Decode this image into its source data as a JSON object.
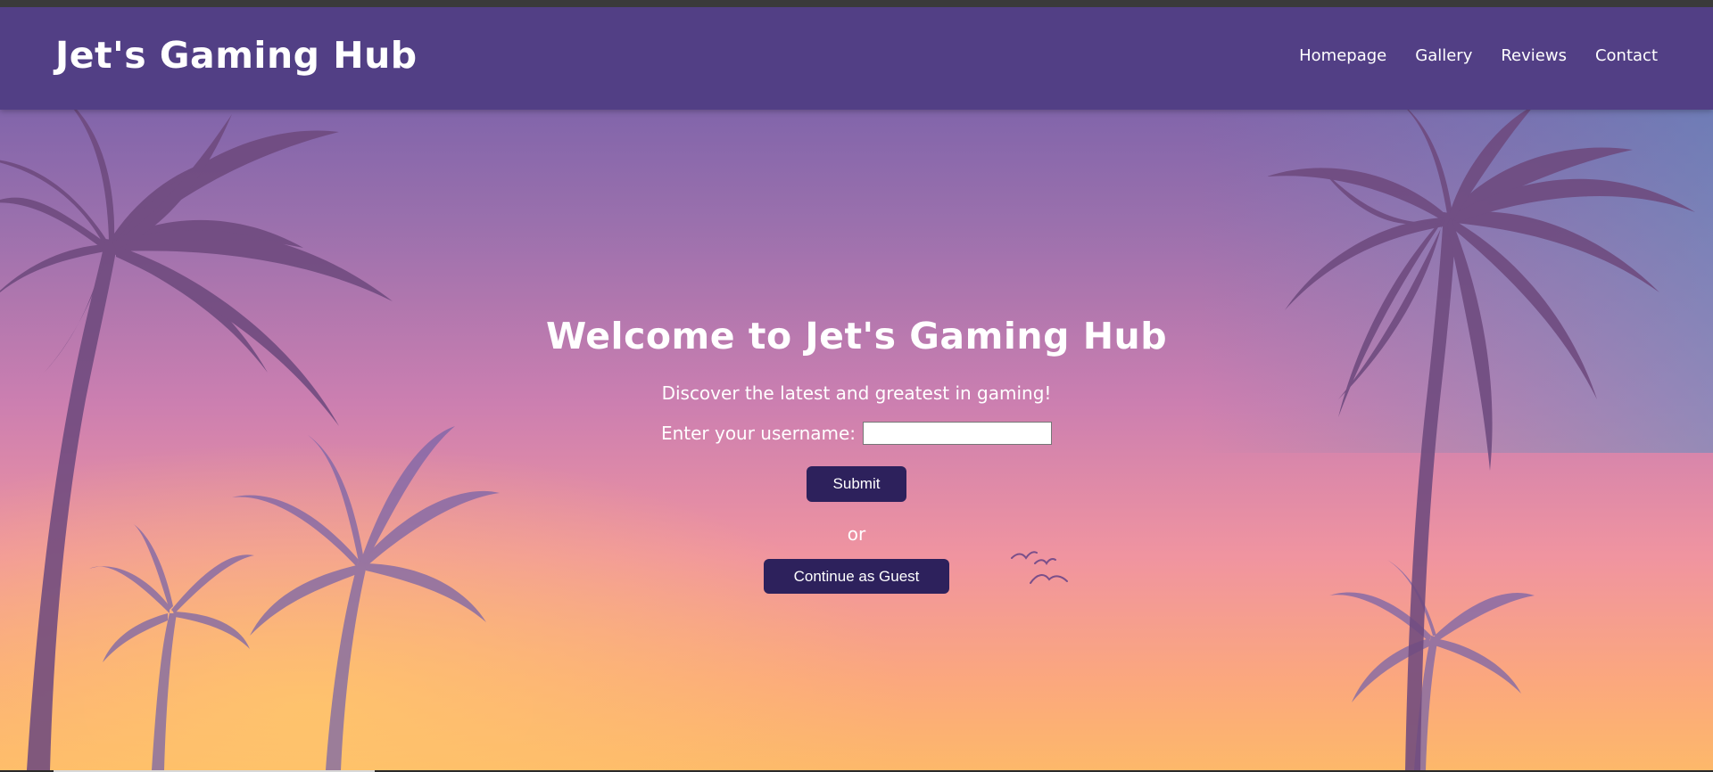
{
  "header": {
    "site_title": "Jet's Gaming Hub",
    "nav": [
      "Homepage",
      "Gallery",
      "Reviews",
      "Contact"
    ]
  },
  "hero": {
    "title": "Welcome to Jet's Gaming Hub",
    "subtitle": "Discover the latest and greatest in gaming!",
    "username_label": "Enter your username:",
    "username_value": "",
    "submit_label": "Submit",
    "or_text": "or",
    "guest_label": "Continue as Guest"
  },
  "colors": {
    "navbar": "#523f85",
    "button": "#2d215c",
    "text": "#ffffff",
    "sky_top": "#6f5aa8",
    "sky_mid": "#c77bb0",
    "sky_bottom": "#fdb46a",
    "palm_silhouette": "#6a3d6e"
  },
  "icons": {
    "background_image": "palm-trees-sunset-illustration",
    "birds": "flying-birds-icon"
  }
}
